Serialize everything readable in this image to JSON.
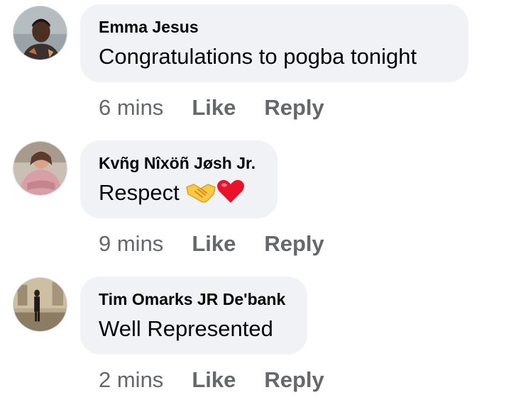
{
  "comments": [
    {
      "author": "Emma Jesus",
      "text": "Congratulations to pogba tonight",
      "time": "6 mins",
      "like_label": "Like",
      "reply_label": "Reply",
      "avatar_icon": "profile-photo-man"
    },
    {
      "author": "Kvñg Nîxöñ Jøsh Jr.",
      "text": "Respect",
      "emojis": [
        "handshake-emoji",
        "red-heart-emoji"
      ],
      "time": "9 mins",
      "like_label": "Like",
      "reply_label": "Reply",
      "avatar_icon": "profile-photo-pink-outfit"
    },
    {
      "author": "Tim Omarks JR De'bank",
      "text": "Well Represented",
      "time": "2 mins",
      "like_label": "Like",
      "reply_label": "Reply",
      "avatar_icon": "profile-photo-standing-figure"
    }
  ],
  "colors": {
    "bubble_bg": "#f0f2f5",
    "meta_text": "#65676b",
    "primary_text": "#050505",
    "heart": "#e8132a"
  }
}
